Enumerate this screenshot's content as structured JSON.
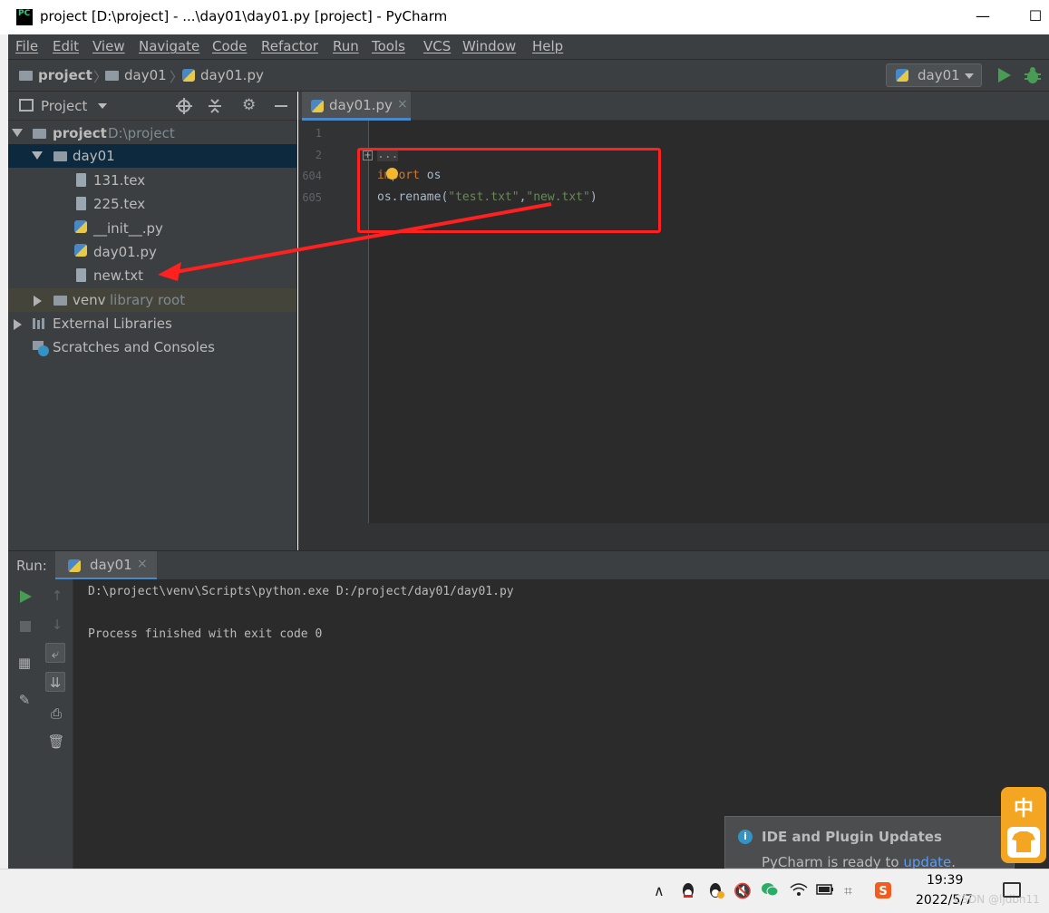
{
  "window": {
    "title": "project [D:\\project] - ...\\day01\\day01.py [project] - PyCharm",
    "app_icon_text": "PC",
    "minimize_glyph": "—",
    "maximize_glyph": "☐"
  },
  "menu": [
    "File",
    "Edit",
    "View",
    "Navigate",
    "Code",
    "Refactor",
    "Run",
    "Tools",
    "VCS",
    "Window",
    "Help"
  ],
  "breadcrumbs": [
    "project",
    "day01",
    "day01.py"
  ],
  "run_config": {
    "label": "day01"
  },
  "project_panel": {
    "header": "Project",
    "tree": [
      {
        "label": "project",
        "sub": "D:\\project",
        "bold": true
      },
      {
        "label": "day01"
      },
      {
        "label": "131.tex"
      },
      {
        "label": "225.tex"
      },
      {
        "label": "__init__.py"
      },
      {
        "label": "day01.py"
      },
      {
        "label": "new.txt"
      },
      {
        "label": "venv",
        "sub": "library root"
      },
      {
        "label": "External Libraries"
      },
      {
        "label": "Scratches and Consoles"
      }
    ]
  },
  "editor": {
    "tab_label": "day01.py",
    "tab_close": "×",
    "line_numbers": [
      "1",
      "2",
      "604",
      "605"
    ],
    "fold_text": "...",
    "line604": {
      "kw": "import",
      "rest": " os"
    },
    "line605": {
      "prefix": "os.rename(",
      "arg1": "\"test.txt\"",
      "sep": ",",
      "arg2": "\"new.txt\"",
      "suffix": ")"
    }
  },
  "run_panel": {
    "label": "Run:",
    "tab_label": "day01",
    "tab_close": "×",
    "console": [
      "D:\\project\\venv\\Scripts\\python.exe D:/project/day01/day01.py",
      "",
      "Process finished with exit code 0"
    ]
  },
  "notification": {
    "icon": "i",
    "title": "IDE and Plugin Updates",
    "body": "PyCharm is ready to ",
    "link": "update",
    "end": "."
  },
  "ime": {
    "char": "中"
  },
  "taskbar": {
    "time": "19:39",
    "date": "2022/5/7",
    "watermark": "CSDN @ljdbn11"
  },
  "colors": {
    "accent": "#4a88c7",
    "background": "#2b2b2b",
    "panel": "#3c3f41",
    "annotation": "#ff2020"
  }
}
